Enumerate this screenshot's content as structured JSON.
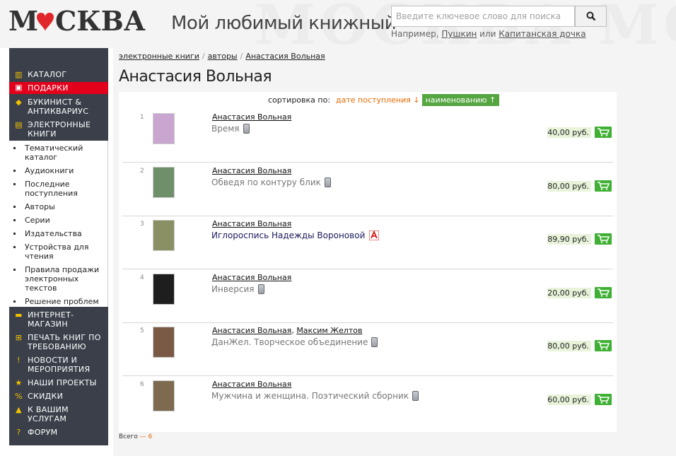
{
  "header": {
    "logo": "МОСКВА",
    "tagline": "Мой любимый книжный",
    "search_placeholder": "Введите ключевое слово для поиска",
    "hint_prefix": "Например,",
    "hint_link1": "Пушкин",
    "hint_or": "или",
    "hint_link2": "Капитанская дочка"
  },
  "sidebar": {
    "items_top": [
      {
        "label": "Каталог",
        "icon": "books-icon"
      },
      {
        "label": "Подарки",
        "icon": "gift-icon",
        "active": true
      },
      {
        "label": "Букинист & антиквариус",
        "icon": "antique-icon"
      },
      {
        "label": "Электронные книги",
        "icon": "ebook-icon"
      }
    ],
    "sub_items": [
      "Тематический каталог",
      "Аудиокниги",
      "Последние поступления",
      "Авторы",
      "Серии",
      "Издательства",
      "Устройства для чтения",
      "Правила продажи электронных текстов",
      "Решение проблем"
    ],
    "items_bottom": [
      {
        "label": "Интернет-магазин",
        "icon": "cart-icon"
      },
      {
        "label": "Печать книг по требованию",
        "icon": "print-icon"
      },
      {
        "label": "Новости и мероприятия",
        "icon": "exclamation-icon"
      },
      {
        "label": "Наши проекты",
        "icon": "star-icon"
      },
      {
        "label": "Скидки",
        "icon": "percent-icon"
      },
      {
        "label": "К вашим услугам",
        "icon": "bag-icon"
      },
      {
        "label": "Форум",
        "icon": "question-icon"
      }
    ]
  },
  "breadcrumb": [
    "электронные книги",
    "авторы",
    "Анастасия Вольная"
  ],
  "page_title": "Анастасия Вольная",
  "sort": {
    "label": "сортировка по:",
    "by_date": "дате поступления ↓",
    "by_name": "наименованию ↑"
  },
  "products": [
    {
      "num": "1",
      "authors": [
        "Анастасия Вольная"
      ],
      "title": "Время",
      "format": "device",
      "price": "40,00 руб.",
      "cover_color": "#c9a6cf"
    },
    {
      "num": "2",
      "authors": [
        "Анастасия Вольная"
      ],
      "title": "Обведя по контуру блик",
      "format": "device",
      "price": "80,00 руб.",
      "cover_color": "#6f8f6a"
    },
    {
      "num": "3",
      "authors": [
        "Анастасия Вольная"
      ],
      "title": "Иглороспись Надежды Вороновой",
      "format": "pdf",
      "price": "89,90 руб.",
      "cover_color": "#8a8f64"
    },
    {
      "num": "4",
      "authors": [
        "Анастасия Вольная"
      ],
      "title": "Инверсия",
      "format": "device",
      "price": "20,00 руб.",
      "cover_color": "#1e1e1e"
    },
    {
      "num": "5",
      "authors": [
        "Анастасия Вольная",
        "Максим Желтов"
      ],
      "title": "ДанЖел. Творческое объединение",
      "format": "device",
      "price": "80,00 руб.",
      "cover_color": "#7a5a45"
    },
    {
      "num": "6",
      "authors": [
        "Анастасия Вольная"
      ],
      "title": "Мужчина и женщина. Поэтический сборник",
      "format": "device",
      "price": "60,00 руб.",
      "cover_color": "#7d6a4f"
    }
  ],
  "total": {
    "label": "Всего",
    "dash": "—",
    "count": "6"
  }
}
